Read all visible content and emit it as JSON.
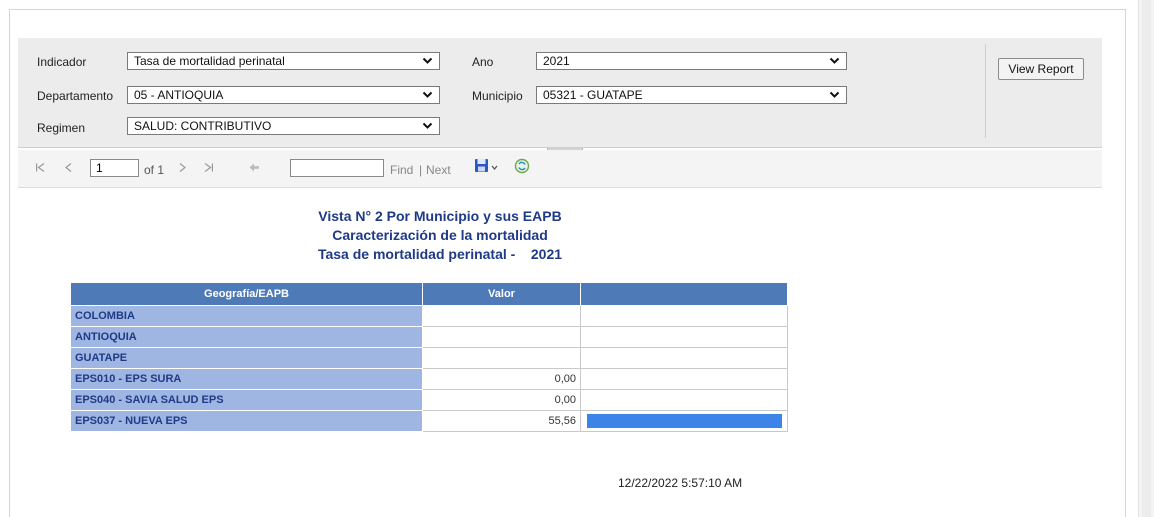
{
  "params": {
    "indicador_label": "Indicador",
    "indicador_value": "Tasa de mortalidad perinatal",
    "ano_label": "Ano",
    "ano_value": "2021",
    "departamento_label": "Departamento",
    "departamento_value": "05 - ANTIOQUIA",
    "municipio_label": "Municipio",
    "municipio_value": "05321 - GUATAPE",
    "regimen_label": "Regimen",
    "regimen_value": "SALUD: CONTRIBUTIVO",
    "view_report": "View Report"
  },
  "toolbar": {
    "page_value": "1",
    "of_pages": "of 1",
    "find": "Find",
    "separator": "|",
    "next": "Next"
  },
  "report": {
    "title1": "Vista N° 2 Por Municipio y sus EAPB",
    "title2": "Caracterización de la mortalidad",
    "title3": "Tasa de mortalidad perinatal -    2021",
    "col_geo": "Geografía/EAPB",
    "col_valor": "Valor",
    "col_bar": "",
    "max_value": 55.56,
    "rows": [
      {
        "geo": "COLOMBIA",
        "valor": "",
        "bar_value": 0
      },
      {
        "geo": "ANTIOQUIA",
        "valor": "",
        "bar_value": 0
      },
      {
        "geo": "GUATAPE",
        "valor": "",
        "bar_value": 0
      },
      {
        "geo": "EPS010 - EPS SURA",
        "valor": "0,00",
        "bar_value": 0
      },
      {
        "geo": "EPS040 - SAVIA SALUD EPS",
        "valor": "0,00",
        "bar_value": 0
      },
      {
        "geo": "EPS037 - NUEVA EPS",
        "valor": "55,56",
        "bar_value": 55.56
      }
    ],
    "timestamp": "12/22/2022 5:57:10 AM"
  },
  "colors": {
    "header_bg": "#4f7ab8",
    "geo_bg": "#9fb6e2",
    "title_color": "#1f3a87",
    "bar_color": "#3d84e8"
  }
}
